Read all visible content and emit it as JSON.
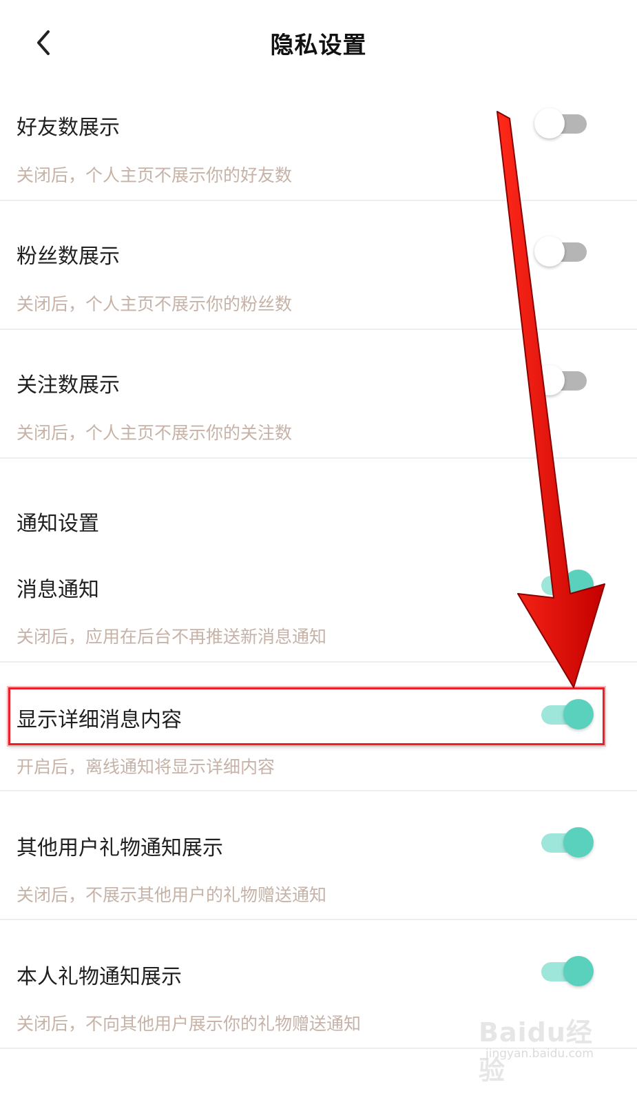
{
  "header": {
    "title": "隐私设置",
    "back_icon": "chevron-left-icon"
  },
  "settings": [
    {
      "label": "好友数展示",
      "desc": "关闭后，个人主页不展示你的好友数",
      "enabled": false
    },
    {
      "label": "粉丝数展示",
      "desc": "关闭后，个人主页不展示你的粉丝数",
      "enabled": false
    },
    {
      "label": "关注数展示",
      "desc": "关闭后，个人主页不展示你的关注数",
      "enabled": false
    }
  ],
  "notification_section": {
    "title": "通知设置",
    "items": [
      {
        "label": "消息通知",
        "desc": "关闭后，应用在后台不再推送新消息通知",
        "enabled": true
      },
      {
        "label": "显示详细消息内容",
        "desc": "开启后，离线通知将显示详细内容",
        "enabled": true
      },
      {
        "label": "其他用户礼物通知展示",
        "desc": "关闭后，不展示其他用户的礼物赠送通知",
        "enabled": true
      },
      {
        "label": "本人礼物通知展示",
        "desc": "关闭后，不向其他用户展示你的礼物赠送通知",
        "enabled": true
      }
    ]
  },
  "watermark": {
    "brand": "Baidu经验",
    "url": "jingyan.baidu.com"
  },
  "colors": {
    "toggle_on_track": "#9ee6da",
    "toggle_on_knob": "#5ad1bd",
    "toggle_off_track": "#b5b5b5",
    "description_text": "#c6b2a7",
    "annotation_red": "#ff0000"
  }
}
